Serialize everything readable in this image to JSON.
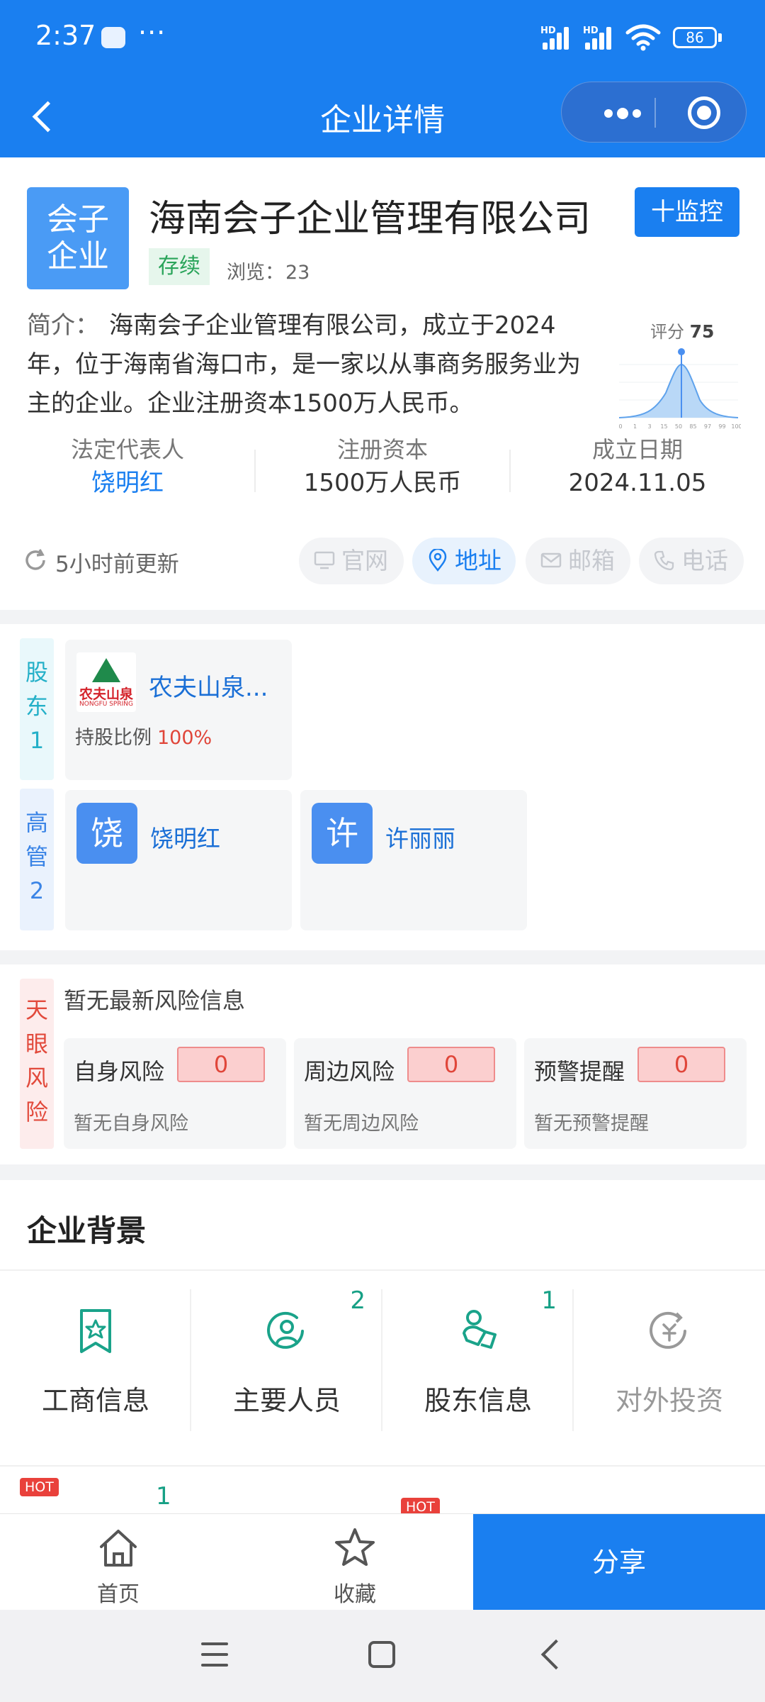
{
  "status_bar": {
    "time": "2:37",
    "dots": "···",
    "hd1": "HD",
    "hd2": "HD",
    "battery": "86"
  },
  "nav": {
    "title": "企业详情"
  },
  "company": {
    "logo_line1": "会子",
    "logo_line2": "企业",
    "name": "海南会子企业管理有限公司",
    "monitor_label": "十监控",
    "status": "存续",
    "views_label": "浏览：",
    "views_count": "23",
    "intro_label": "简介：",
    "intro": "海南会子企业管理有限公司，成立于2024年，位于海南省海口市，是一家以从事商务服务业为主的企业。企业注册资本1500万人民币。",
    "score_label": "评分",
    "score_value": "75",
    "score_ticks": [
      "0",
      "1",
      "3",
      "15",
      "50",
      "85",
      "97",
      "99",
      "100"
    ],
    "legal_rep_label": "法定代表人",
    "legal_rep": "饶明红",
    "capital_label": "注册资本",
    "capital": "1500万人民币",
    "founded_label": "成立日期",
    "founded": "2024.11.05",
    "updated": "5小时前更新",
    "chips": [
      "官网",
      "地址",
      "邮箱",
      "电话"
    ]
  },
  "shareholders": {
    "tag": [
      "股",
      "东",
      "1"
    ],
    "items": [
      {
        "name": "农夫山泉...",
        "logo_cn": "农夫山泉",
        "logo_en": "NONGFU SPRING",
        "ratio_label": "持股比例",
        "ratio": "100%"
      }
    ]
  },
  "management": {
    "tag": [
      "高",
      "管",
      "2"
    ],
    "items": [
      {
        "avatar": "饶",
        "name": "饶明红"
      },
      {
        "avatar": "许",
        "name": "许丽丽"
      }
    ]
  },
  "risk": {
    "tag": [
      "天",
      "眼",
      "风",
      "险"
    ],
    "headline": "暂无最新风险信息",
    "items": [
      {
        "title": "自身风险",
        "count": "0",
        "desc": "暂无自身风险"
      },
      {
        "title": "周边风险",
        "count": "0",
        "desc": "暂无周边风险"
      },
      {
        "title": "预警提醒",
        "count": "0",
        "desc": "暂无预警提醒"
      }
    ]
  },
  "background": {
    "title": "企业背景",
    "items": [
      {
        "label": "工商信息",
        "count": ""
      },
      {
        "label": "主要人员",
        "count": "2"
      },
      {
        "label": "股东信息",
        "count": "1"
      },
      {
        "label": "对外投资",
        "count": ""
      }
    ],
    "hot_label": "HOT",
    "row2_count": "1"
  },
  "tabbar": {
    "home": "首页",
    "favorite": "收藏",
    "share": "分享"
  },
  "colors": {
    "primary": "#1a7ff0",
    "success": "#2aa45a",
    "danger": "#e0463a",
    "teal": "#16a085"
  }
}
